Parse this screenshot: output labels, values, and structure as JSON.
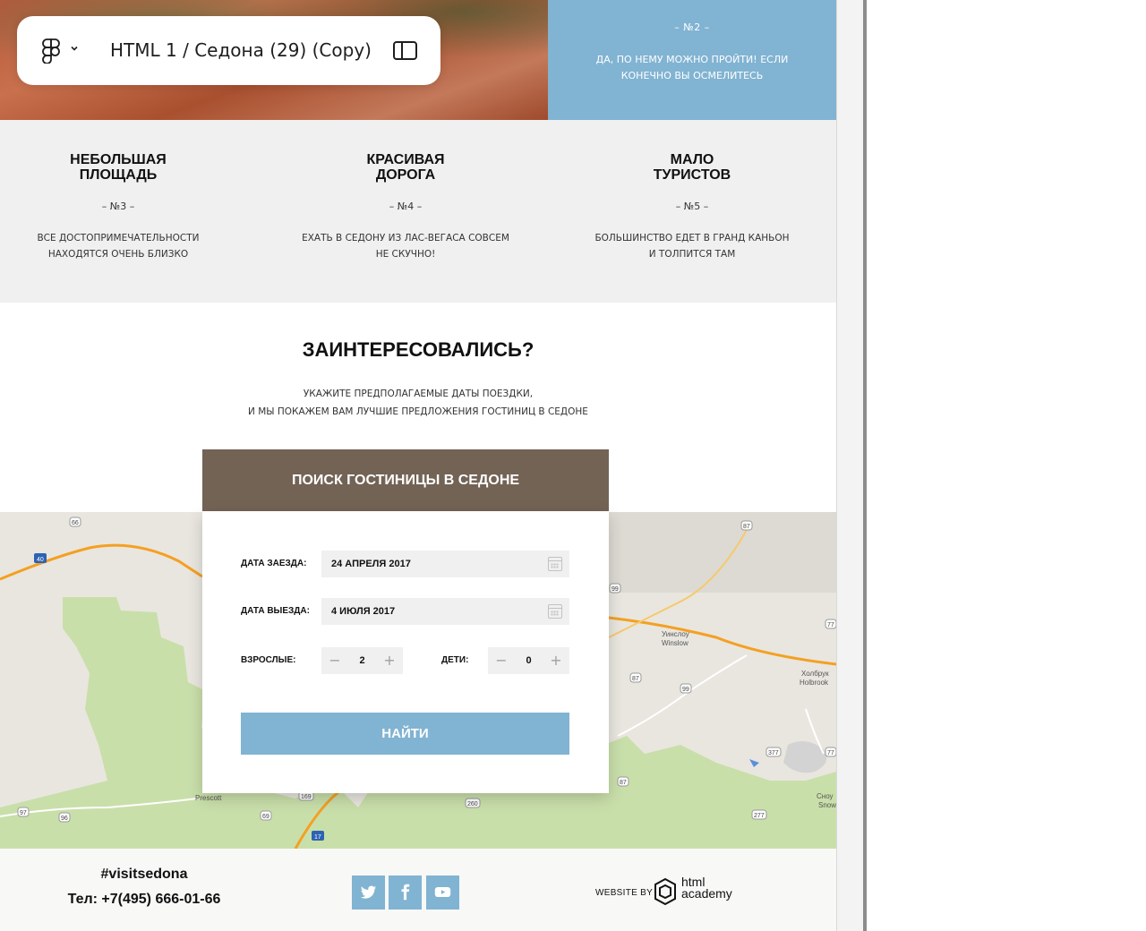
{
  "figma": {
    "doc_title": "HTML 1 / Седона (29) (Copy)"
  },
  "hero": {
    "num": "– №2 –",
    "text": "Да, по нему можно пройти! Если конечно вы осмелитесь"
  },
  "features": [
    {
      "title_line1": "Небольшая",
      "title_line2": "площадь",
      "num": "– №3 –",
      "desc_line1": "Все достопримечательности",
      "desc_line2": "находятся очень близко"
    },
    {
      "title_line1": "Красивая",
      "title_line2": "дорога",
      "num": "– №4 –",
      "desc_line1": "Ехать в Седону из Лас-Вегаса совсем",
      "desc_line2": "не скучно!"
    },
    {
      "title_line1": "Мало",
      "title_line2": "туристов",
      "num": "– №5 –",
      "desc_line1": "Большинство едет в Гранд Каньон",
      "desc_line2": "и толпится там"
    }
  ],
  "interest": {
    "title": "Заинтересовались?",
    "sub_line1": "Укажите предполагаемые даты поездки,",
    "sub_line2": "и мы покажем вам лучшие предложения гостиниц в Седоне"
  },
  "form": {
    "title": "Поиск гостиницы в Седоне",
    "checkin_label": "Дата заезда:",
    "checkin_value": "24 апреля 2017",
    "checkout_label": "Дата выезда:",
    "checkout_value": "4 июля 2017",
    "adults_label": "Взрослые:",
    "adults_value": "2",
    "children_label": "Дети:",
    "children_value": "0",
    "minus": "−",
    "plus": "+",
    "submit": "Найти"
  },
  "map": {
    "labels": {
      "winslow_ru": "Уинслоу",
      "winslow_en": "Winslow",
      "holbrook_ru": "Холбрук",
      "holbrook_en": "Holbrook",
      "prescott": "Prescott",
      "snow_ru": "Сноу",
      "snow_en": "Snow"
    },
    "routes": [
      "66",
      "40",
      "87",
      "99",
      "99",
      "87",
      "77",
      "377",
      "77",
      "87",
      "169",
      "69",
      "260",
      "17",
      "97",
      "96",
      "277"
    ]
  },
  "footer": {
    "hashtag": "#visitsedona",
    "phone": "Тел: +7(495) 666-01-66",
    "website_by": "WEBSITE BY",
    "academy_line1": "html",
    "academy_line2": "academy"
  },
  "colors": {
    "accent_blue": "#81b3d2",
    "brown": "#736355",
    "gray_bg": "#f0f0f0"
  }
}
